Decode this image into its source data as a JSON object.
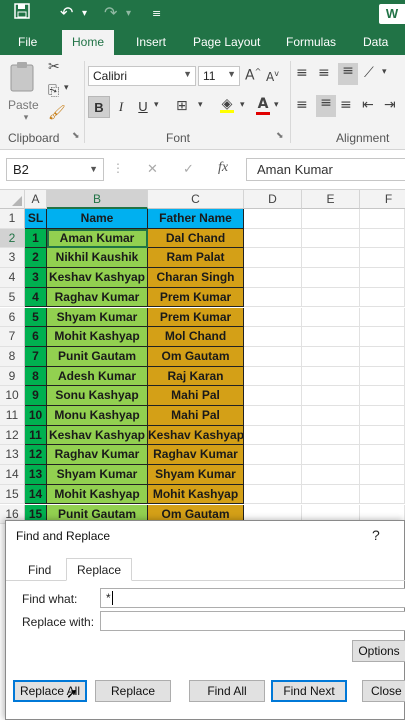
{
  "quick_access": {
    "save_icon": "save-icon",
    "undo_icon": "undo-icon",
    "redo_icon": "redo-icon",
    "customize_icon": "customize-icon",
    "brand_text": "W"
  },
  "ribbon_tabs": [
    "File",
    "Home",
    "Insert",
    "Page Layout",
    "Formulas",
    "Data"
  ],
  "active_tab": "Home",
  "ribbon": {
    "paste_label": "Paste",
    "clipboard_label": "Clipboard",
    "font_label": "Font",
    "alignment_label": "Alignment",
    "font_name": "Calibri",
    "font_size": "11",
    "increase_font": "A",
    "decrease_font": "A",
    "bold": "B",
    "italic": "I",
    "underline": "U",
    "font_color_letter": "A"
  },
  "formula_bar": {
    "name_box": "B2",
    "fx": "fx",
    "cancel": "✕",
    "enter": "✓",
    "content": "Aman Kumar"
  },
  "grid": {
    "columns": [
      "A",
      "B",
      "C",
      "D",
      "E",
      "F"
    ],
    "row_numbers": [
      "1",
      "2",
      "3",
      "4",
      "5",
      "6",
      "7",
      "8",
      "9",
      "10",
      "11",
      "12",
      "13",
      "14",
      "15",
      "16"
    ],
    "header": {
      "sl": "SL",
      "name": "Name",
      "father": "Father Name"
    },
    "rows": [
      {
        "sl": "1",
        "name": "Aman Kumar",
        "father": "Dal Chand"
      },
      {
        "sl": "2",
        "name": "Nikhil Kaushik",
        "father": "Ram Palat"
      },
      {
        "sl": "3",
        "name": "Keshav Kashyap",
        "father": "Charan Singh"
      },
      {
        "sl": "4",
        "name": "Raghav Kumar",
        "father": "Prem Kumar"
      },
      {
        "sl": "5",
        "name": "Shyam Kumar",
        "father": "Prem Kumar"
      },
      {
        "sl": "6",
        "name": "Mohit Kashyap",
        "father": "Mol Chand"
      },
      {
        "sl": "7",
        "name": "Punit Gautam",
        "father": "Om Gautam"
      },
      {
        "sl": "8",
        "name": "Adesh Kumar",
        "father": "Raj Karan"
      },
      {
        "sl": "9",
        "name": "Sonu Kashyap",
        "father": "Mahi Pal"
      },
      {
        "sl": "10",
        "name": "Monu Kashyap",
        "father": "Mahi Pal"
      },
      {
        "sl": "11",
        "name": "Keshav Kashyap",
        "father": "Keshav Kashyap"
      },
      {
        "sl": "12",
        "name": "Raghav Kumar",
        "father": "Raghav Kumar"
      },
      {
        "sl": "13",
        "name": "Shyam Kumar",
        "father": "Shyam Kumar"
      },
      {
        "sl": "14",
        "name": "Mohit Kashyap",
        "father": "Mohit Kashyap"
      },
      {
        "sl": "15",
        "name": "Punit Gautam",
        "father": "Om Gautam"
      }
    ]
  },
  "colors": {
    "excel_green": "#217346",
    "header_fill": "#00b0f0",
    "sl_fill": "#00b050",
    "name_fill": "#92d050",
    "father_fill": "#d4a017"
  },
  "dialog": {
    "title": "Find and Replace",
    "help": "?",
    "tabs": [
      "Find",
      "Replace"
    ],
    "active_tab": "Replace",
    "find_label": "Find what:",
    "find_value": "*",
    "replace_label": "Replace with:",
    "replace_value": "",
    "options_button": "Options",
    "buttons": {
      "replace_all": "Replace All",
      "replace": "Replace",
      "find_all": "Find All",
      "find_next": "Find Next",
      "close": "Close"
    }
  }
}
